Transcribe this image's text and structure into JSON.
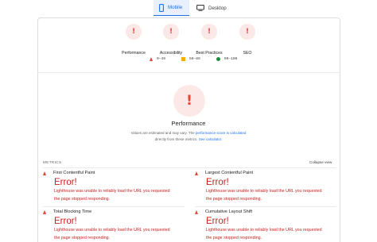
{
  "tabs": [
    {
      "label": "Mobile",
      "icon": "phone-icon",
      "active": true
    },
    {
      "label": "Desktop",
      "icon": "monitor-icon",
      "active": false
    }
  ],
  "categories": [
    {
      "label": "Performance",
      "icon": "!"
    },
    {
      "label": "Accessibility",
      "icon": "!"
    },
    {
      "label": "Best Practices",
      "icon": "!"
    },
    {
      "label": "SEO",
      "icon": "!"
    }
  ],
  "legend": [
    {
      "range": "0–49",
      "symbol": "triangle",
      "color": "#ea4335"
    },
    {
      "range": "50–89",
      "symbol": "square",
      "color": "#f9ab00"
    },
    {
      "range": "90–100",
      "symbol": "circle",
      "color": "#1e8e3e"
    }
  ],
  "performance": {
    "icon": "!",
    "title": "Performance",
    "note_prefix": "Values are estimated and may vary. The",
    "note_link1": "performance score is calculated",
    "note_mid": "directly from these metrics.",
    "note_link2": "See calculator."
  },
  "metrics": {
    "header": "METRICS",
    "collapse_label": "Collapse view",
    "items": [
      {
        "name": "First Contentful Paint",
        "error": "Error!",
        "desc1": "Lighthouse was unable to reliably load the URL you requested",
        "desc2": "the page stopped responding."
      },
      {
        "name": "Largest Contentful Paint",
        "error": "Error!",
        "desc1": "Lighthouse was unable to reliably load the URL you requested",
        "desc2": "the page stopped responding."
      },
      {
        "name": "Total Blocking Time",
        "error": "Error!",
        "desc1": "Lighthouse was unable to reliably load the URL you requested",
        "desc2": "the page stopped responding."
      },
      {
        "name": "Cumulative Layout Shift",
        "error": "Error!",
        "desc1": "Lighthouse was unable to reliably load the URL you requested",
        "desc2": "the page stopped responding."
      }
    ]
  },
  "colors": {
    "accent": "#1a73e8",
    "fail": "#ea4335",
    "fail_text": "#c5221f",
    "average": "#f9ab00",
    "pass": "#1e8e3e"
  }
}
